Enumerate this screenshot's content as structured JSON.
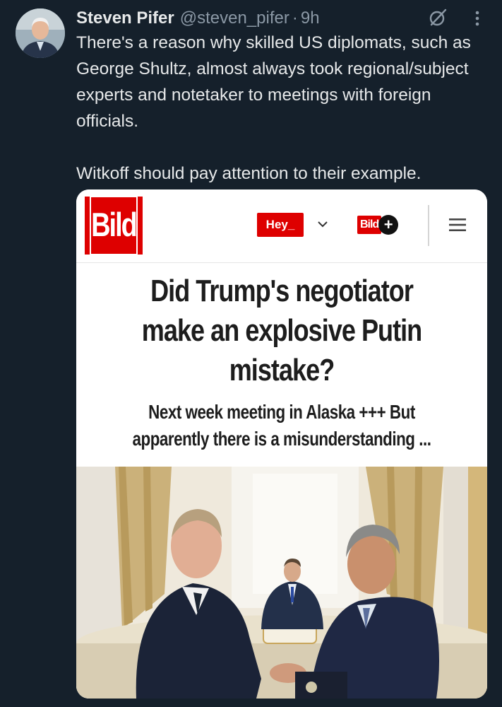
{
  "tweet": {
    "author_name": "Steven Pifer",
    "handle": "@steven_pifer",
    "separator": "·",
    "time": "9h",
    "paragraphs": [
      "There's a reason why skilled US diplomats, such as George Shultz, almost always took regional/subject experts and notetaker to meetings with foreign officials.",
      "Witkoff should pay attention to their example."
    ],
    "icons": {
      "grok": "grok-icon",
      "more": "more-vertical-icon",
      "avatar": "avatar"
    }
  },
  "media": {
    "site": {
      "logo_text": "Bild",
      "hey_label": "Hey_",
      "bildplus_text": "Bild",
      "bildplus_symbol": "+",
      "brand_color": "#de0000"
    },
    "headline": "Did Trump's negotiator make an explosive Putin mistake?",
    "subheadline": "Next week meeting in Alaska +++ But apparently there is a misunderstanding ...",
    "photo": "handshake-photo"
  },
  "colors": {
    "background": "#15202b",
    "text_primary": "#e7e9ea",
    "text_secondary": "#8b98a5"
  }
}
